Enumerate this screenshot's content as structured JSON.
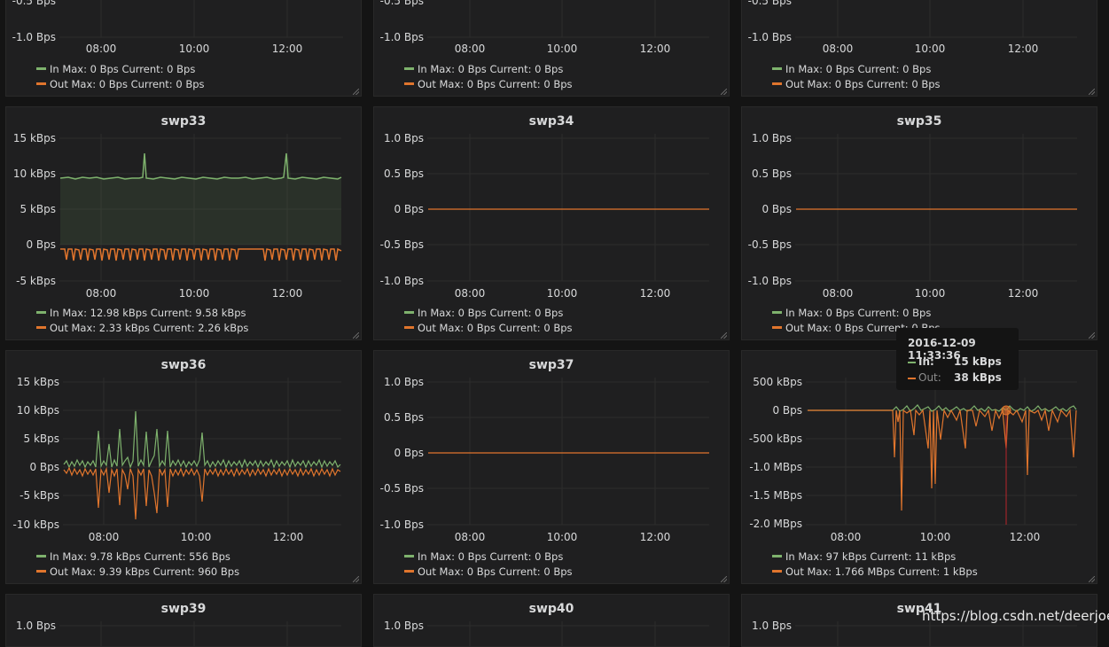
{
  "colors": {
    "in": "#7eb26d",
    "out": "#e0752d"
  },
  "x_ticks": [
    "08:00",
    "10:00",
    "12:00"
  ],
  "panels": [
    {
      "id": "p00",
      "title": "",
      "y_ticks": [
        "-0.5 Bps",
        "-1.0 Bps"
      ],
      "legend_in": "In  Max: 0 Bps  Current: 0 Bps",
      "legend_out": "Out  Max: 0 Bps  Current: 0 Bps"
    },
    {
      "id": "p01",
      "title": "",
      "y_ticks": [
        "-0.5 Bps",
        "-1.0 Bps"
      ],
      "legend_in": "In  Max: 0 Bps  Current: 0 Bps",
      "legend_out": "Out  Max: 0 Bps  Current: 0 Bps"
    },
    {
      "id": "p02",
      "title": "",
      "y_ticks": [
        "-0.5 Bps",
        "-1.0 Bps"
      ],
      "legend_in": "In  Max: 0 Bps  Current: 0 Bps",
      "legend_out": "Out  Max: 0 Bps  Current: 0 Bps"
    },
    {
      "id": "p10",
      "title": "swp33",
      "y_ticks": [
        "15 kBps",
        "10 kBps",
        "5 kBps",
        "0 Bps",
        "-5 kBps"
      ],
      "legend_in": "In  Max: 12.98 kBps  Current: 9.58 kBps",
      "legend_out": "Out  Max: 2.33 kBps  Current: 2.26 kBps"
    },
    {
      "id": "p11",
      "title": "swp34",
      "y_ticks": [
        "1.0 Bps",
        "0.5 Bps",
        "0 Bps",
        "-0.5 Bps",
        "-1.0 Bps"
      ],
      "legend_in": "In  Max: 0 Bps  Current: 0 Bps",
      "legend_out": "Out  Max: 0 Bps  Current: 0 Bps"
    },
    {
      "id": "p12",
      "title": "swp35",
      "y_ticks": [
        "1.0 Bps",
        "0.5 Bps",
        "0 Bps",
        "-0.5 Bps",
        "-1.0 Bps"
      ],
      "legend_in": "In  Max: 0 Bps  Current: 0 Bps",
      "legend_out": "Out  Max: 0 Bps  Current: 0 Bps"
    },
    {
      "id": "p20",
      "title": "swp36",
      "y_ticks": [
        "15 kBps",
        "10 kBps",
        "5 kBps",
        "0 Bps",
        "-5 kBps",
        "-10 kBps"
      ],
      "legend_in": "In  Max: 9.78 kBps  Current: 556 Bps",
      "legend_out": "Out  Max: 9.39 kBps  Current: 960 Bps"
    },
    {
      "id": "p21",
      "title": "swp37",
      "y_ticks": [
        "1.0 Bps",
        "0.5 Bps",
        "0 Bps",
        "-0.5 Bps",
        "-1.0 Bps"
      ],
      "legend_in": "In  Max: 0 Bps  Current: 0 Bps",
      "legend_out": "Out  Max: 0 Bps  Current: 0 Bps"
    },
    {
      "id": "p22",
      "title": "",
      "y_ticks": [
        "500 kBps",
        "0 Bps",
        "-500 kBps",
        "-1.0 MBps",
        "-1.5 MBps",
        "-2.0 MBps"
      ],
      "legend_in": "In  Max: 97 kBps  Current: 11 kBps",
      "legend_out": "Out  Max: 1.766 MBps  Current: 1 kBps"
    },
    {
      "id": "p30",
      "title": "swp39",
      "y_ticks": [
        "1.0 Bps"
      ],
      "legend_in": "",
      "legend_out": ""
    },
    {
      "id": "p31",
      "title": "swp40",
      "y_ticks": [
        "1.0 Bps"
      ],
      "legend_in": "",
      "legend_out": ""
    },
    {
      "id": "p32",
      "title": "swp41",
      "y_ticks": [
        "1.0 Bps"
      ],
      "legend_in": "",
      "legend_out": ""
    }
  ],
  "tooltip": {
    "time": "2016-12-09 11:33:36",
    "in_label": "In:",
    "in_value": "15 kBps",
    "out_label": "Out:",
    "out_value": "38 kBps"
  },
  "watermark": "https://blog.csdn.net/deerjoe"
}
